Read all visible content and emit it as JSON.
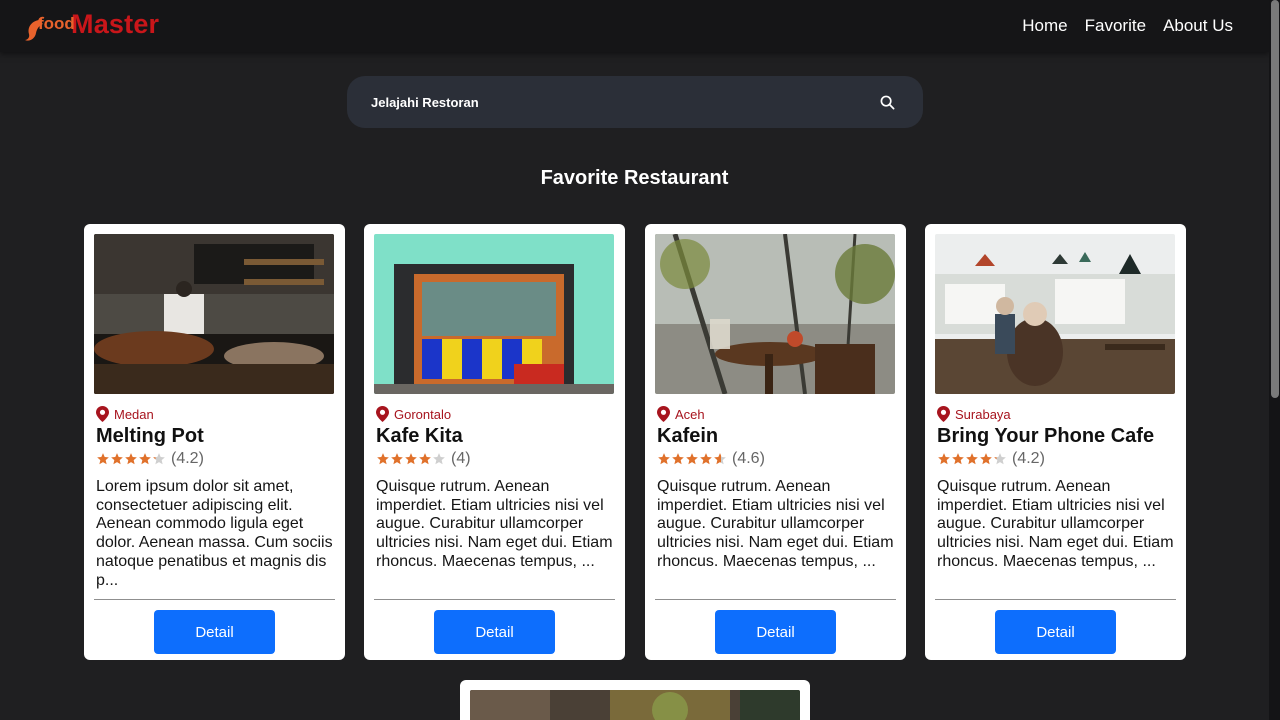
{
  "brand": {
    "food": "food",
    "master": "Master",
    "food_color": "#e8622c",
    "master_color": "#c9161a"
  },
  "nav": {
    "items": [
      {
        "label": "Home"
      },
      {
        "label": "Favorite"
      },
      {
        "label": "About Us"
      }
    ]
  },
  "search": {
    "placeholder": "Jelajahi Restoran",
    "icon": "search-icon"
  },
  "section": {
    "title": "Favorite Restaurant"
  },
  "colors": {
    "background": "#1f1f21",
    "navbar": "#151517",
    "search_bg": "#2b2f38",
    "accent_button": "#0d6efd",
    "location_text": "#a7141e",
    "star": "#e0712b"
  },
  "restaurants": [
    {
      "city": "Medan",
      "name": "Melting Pot",
      "rating": 4.2,
      "rating_text": "(4.2)",
      "description": "Lorem ipsum dolor sit amet, consectetuer adipiscing elit. Aenean commodo ligula eget dolor. Aenean massa. Cum sociis natoque penatibus et magnis dis p...",
      "button": "Detail",
      "image": "kitchen-photo"
    },
    {
      "city": "Gorontalo",
      "name": "Kafe Kita",
      "rating": 4,
      "rating_text": "(4)",
      "description": "Quisque rutrum. Aenean imperdiet. Etiam ultricies nisi vel augue. Curabitur ullamcorper ultricies nisi. Nam eget dui. Etiam rhoncus. Maecenas tempus, ...",
      "button": "Detail",
      "image": "storefront-photo"
    },
    {
      "city": "Aceh",
      "name": "Kafein",
      "rating": 4.6,
      "rating_text": "(4.6)",
      "description": "Quisque rutrum. Aenean imperdiet. Etiam ultricies nisi vel augue. Curabitur ullamcorper ultricies nisi. Nam eget dui. Etiam rhoncus. Maecenas tempus, ...",
      "button": "Detail",
      "image": "cafe-table-photo"
    },
    {
      "city": "Surabaya",
      "name": "Bring Your Phone Cafe",
      "rating": 4.2,
      "rating_text": "(4.2)",
      "description": "Quisque rutrum. Aenean imperdiet. Etiam ultricies nisi vel augue. Curabitur ullamcorper ultricies nisi. Nam eget dui. Etiam rhoncus. Maecenas tempus, ...",
      "button": "Detail",
      "image": "cafe-interior-photo"
    }
  ]
}
